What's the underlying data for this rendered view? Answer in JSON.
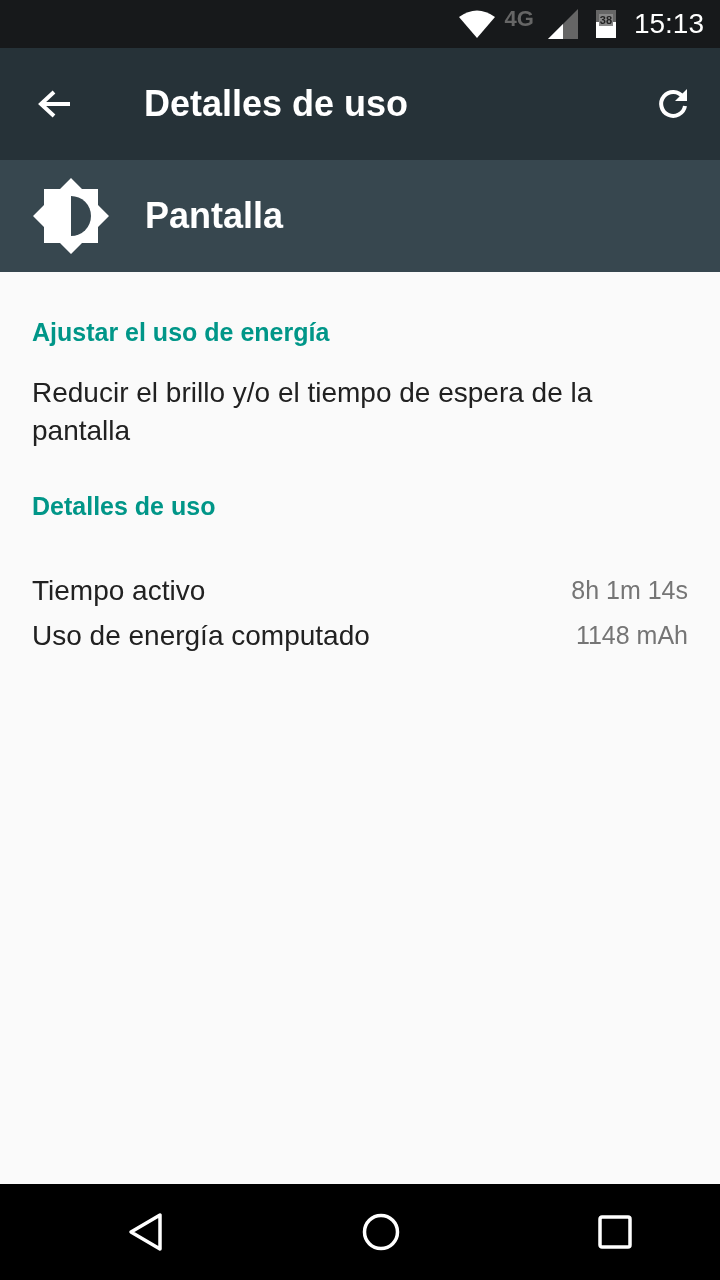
{
  "status_bar": {
    "network": "4G",
    "battery": "38",
    "time": "15:13"
  },
  "app_bar": {
    "title": "Detalles de uso"
  },
  "header": {
    "title": "Pantalla"
  },
  "sections": [
    {
      "kind": "text",
      "heading": "Ajustar el uso de energía",
      "text": "Reducir el brillo y/o el tiempo de espera de la pantalla"
    },
    {
      "kind": "rows",
      "heading": "Detalles de uso",
      "rows": [
        {
          "label": "Tiempo activo",
          "value": "8h 1m 14s"
        },
        {
          "label": "Uso de energía computado",
          "value": "1148 mAh"
        }
      ]
    }
  ]
}
